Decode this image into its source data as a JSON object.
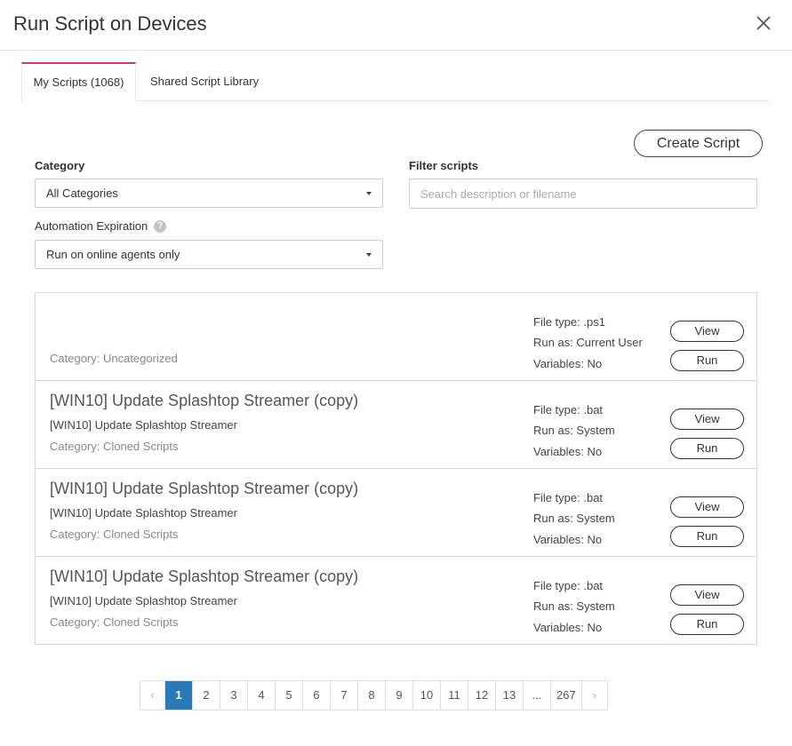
{
  "dialog": {
    "title": "Run Script on Devices"
  },
  "tabs": [
    {
      "label": "My Scripts (1068)"
    },
    {
      "label": "Shared Script Library"
    }
  ],
  "toolbar": {
    "create_label": "Create Script"
  },
  "filters": {
    "category_label": "Category",
    "category_value": "All Categories",
    "filter_label": "Filter scripts",
    "filter_placeholder": "Search description or filename",
    "filter_value": "",
    "expiration_label": "Automation Expiration",
    "expiration_value": "Run on online agents only",
    "help_glyph": "?"
  },
  "scripts": [
    {
      "title": "",
      "description": "",
      "category": "Category: Uncategorized",
      "file_type": "File type: .ps1",
      "run_as": "Run as: Current User",
      "variables": "Variables: No",
      "view_label": "View",
      "run_label": "Run"
    },
    {
      "title": "[WIN10] Update Splashtop Streamer (copy)",
      "description": "[WIN10] Update Splashtop Streamer",
      "category": "Category: Cloned Scripts",
      "file_type": "File type: .bat",
      "run_as": "Run as: System",
      "variables": "Variables: No",
      "view_label": "View",
      "run_label": "Run"
    },
    {
      "title": "[WIN10] Update Splashtop Streamer (copy)",
      "description": "[WIN10] Update Splashtop Streamer",
      "category": "Category: Cloned Scripts",
      "file_type": "File type: .bat",
      "run_as": "Run as: System",
      "variables": "Variables: No",
      "view_label": "View",
      "run_label": "Run"
    },
    {
      "title": "[WIN10] Update Splashtop Streamer (copy)",
      "description": "[WIN10] Update Splashtop Streamer",
      "category": "Category: Cloned Scripts",
      "file_type": "File type: .bat",
      "run_as": "Run as: System",
      "variables": "Variables: No",
      "view_label": "View",
      "run_label": "Run"
    }
  ],
  "pagination": {
    "prev": "‹",
    "next": "›",
    "pages": [
      "1",
      "2",
      "3",
      "4",
      "5",
      "6",
      "7",
      "8",
      "9",
      "10",
      "11",
      "12",
      "13",
      "...",
      "267"
    ],
    "current": "1"
  },
  "colors": {
    "active_tab_accent": "#d6336c",
    "active_page": "#2a7ab8"
  }
}
